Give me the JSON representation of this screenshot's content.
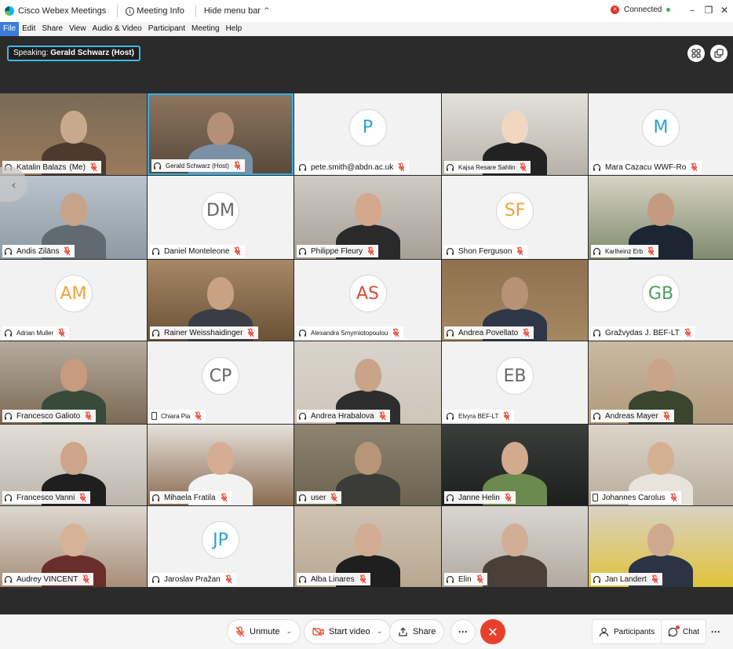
{
  "titlebar": {
    "app_title": "Cisco Webex Meetings",
    "meeting_info": "Meeting Info",
    "hide_menu": "Hide menu bar",
    "connection_status": "Connected"
  },
  "menu": [
    "File",
    "Edit",
    "Share",
    "View",
    "Audio & Video",
    "Participant",
    "Meeting",
    "Help"
  ],
  "speaking": {
    "prefix": "Speaking:",
    "name": "Gerald Schwarz (Host)"
  },
  "participants": [
    {
      "name": "Katalin Balazs",
      "suffix": "(Me)",
      "initials": "",
      "video": true
    },
    {
      "name": "Gerald Schwarz (Host)",
      "initials": "",
      "video": true
    },
    {
      "name": "pete.smith@abdn.ac.uk",
      "initials": "P",
      "video": false
    },
    {
      "name": "Kajsa Resare Sahlin",
      "initials": "",
      "video": true
    },
    {
      "name": "Mara Cazacu WWF-Ro",
      "initials": "M",
      "video": false
    },
    {
      "name": "Andis Zilāns",
      "initials": "",
      "video": true
    },
    {
      "name": "Daniel Monteleone",
      "initials": "DM",
      "video": false
    },
    {
      "name": "Philippe Fleury",
      "initials": "",
      "video": true
    },
    {
      "name": "Shon Ferguson",
      "initials": "SF",
      "video": false
    },
    {
      "name": "Karlheinz Erb",
      "initials": "",
      "video": true
    },
    {
      "name": "Adrian Muller",
      "initials": "AM",
      "video": false
    },
    {
      "name": "Rainer Weisshaidinger",
      "initials": "",
      "video": true
    },
    {
      "name": "Alexandra Smyrniotopoulou",
      "initials": "AS",
      "video": false
    },
    {
      "name": "Andrea Povellato",
      "initials": "",
      "video": true
    },
    {
      "name": "Gražvydas J. BEF-LT",
      "initials": "GB",
      "video": false
    },
    {
      "name": "Francesco Galioto",
      "initials": "",
      "video": true
    },
    {
      "name": "Chiara Pia",
      "initials": "CP",
      "video": false
    },
    {
      "name": "Andrea Hrabalova",
      "initials": "",
      "video": true
    },
    {
      "name": "Elvyra BEF-LT",
      "initials": "EB",
      "video": false
    },
    {
      "name": "Andreas Mayer",
      "initials": "",
      "video": true
    },
    {
      "name": "Francesco Vanni",
      "initials": "",
      "video": true
    },
    {
      "name": "Mihaela Fratila",
      "initials": "",
      "video": true
    },
    {
      "name": "user",
      "initials": "",
      "video": true
    },
    {
      "name": "Janne Helin",
      "initials": "",
      "video": true
    },
    {
      "name": "Johannes Carolus",
      "initials": "",
      "video": true
    },
    {
      "name": "Audrey VINCENT",
      "initials": "",
      "video": true
    },
    {
      "name": "Jaroslav Pražan",
      "initials": "JP",
      "video": false
    },
    {
      "name": "Alba Linares",
      "initials": "",
      "video": true
    },
    {
      "name": "Elin",
      "initials": "",
      "video": true
    },
    {
      "name": "Jan Landert",
      "initials": "",
      "video": true
    }
  ],
  "controls": {
    "unmute": "Unmute",
    "start_video": "Start video",
    "share": "Share",
    "more": "···",
    "participants": "Participants",
    "chat": "Chat",
    "overflow": "···"
  },
  "colors": {
    "accent": "#30b0e3",
    "end_call": "#e8402c",
    "avatar_blue": "#2b9fd6",
    "avatar_orange": "#f0a33a",
    "avatar_red": "#d94b3a",
    "avatar_green": "#4aa05a",
    "avatar_gray": "#666666"
  }
}
